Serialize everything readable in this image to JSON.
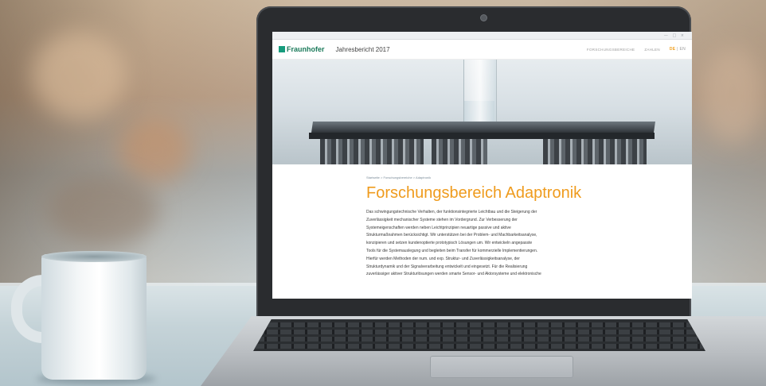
{
  "browser": {
    "controls": "— □ ×"
  },
  "site": {
    "logo_text": "Fraunhofer",
    "report_title": "Jahresbericht 2017",
    "nav": [
      "FORSCHUNGSBEREICHE",
      "ZAHLEN"
    ],
    "lang_de": "DE",
    "lang_sep": "|",
    "lang_en": "EN"
  },
  "page": {
    "breadcrumb": "Startseite > Forschungsbereiche > Adaptronik",
    "title": "Forschungsbereich Adaptronik",
    "body_lines": [
      "Das schwingungstechnische Verhalten, der funktionsintegrierte Leichtbau und die Steigerung der",
      "Zuverlässigkeit mechanischer Systeme stehen im Vordergrund. Zur Verbesserung der",
      "Systemeigenschaften werden neben Leichtprinzipien neuartige passive und aktive",
      "Strukturmaßnahmen berücksichtigt. Wir unterstützen bei der Problem- und Machbarkeitsanalyse,",
      "konzipieren und setzen kundenoptierte prototypisch Lösungen um. Wir entwickeln angepasste",
      "Tools für die Systemauslegung und begleiten beim Transfer für kommerzielle Implementierungen.",
      "Hierfür werden Methoden der num. und exp. Struktur- und Zuverlässigkeitsanalyse, der",
      "Strukturdynamik und der Signalverarbeitung entwickelt und eingesetzt. Für die Realisierung",
      "zuverlässiger aktiver Strukturlösungen werden smarte Sensor- und Aktorsysteme und elektronische"
    ]
  },
  "colors": {
    "accent_orange": "#ef9b1d",
    "brand_green": "#179c7d"
  }
}
